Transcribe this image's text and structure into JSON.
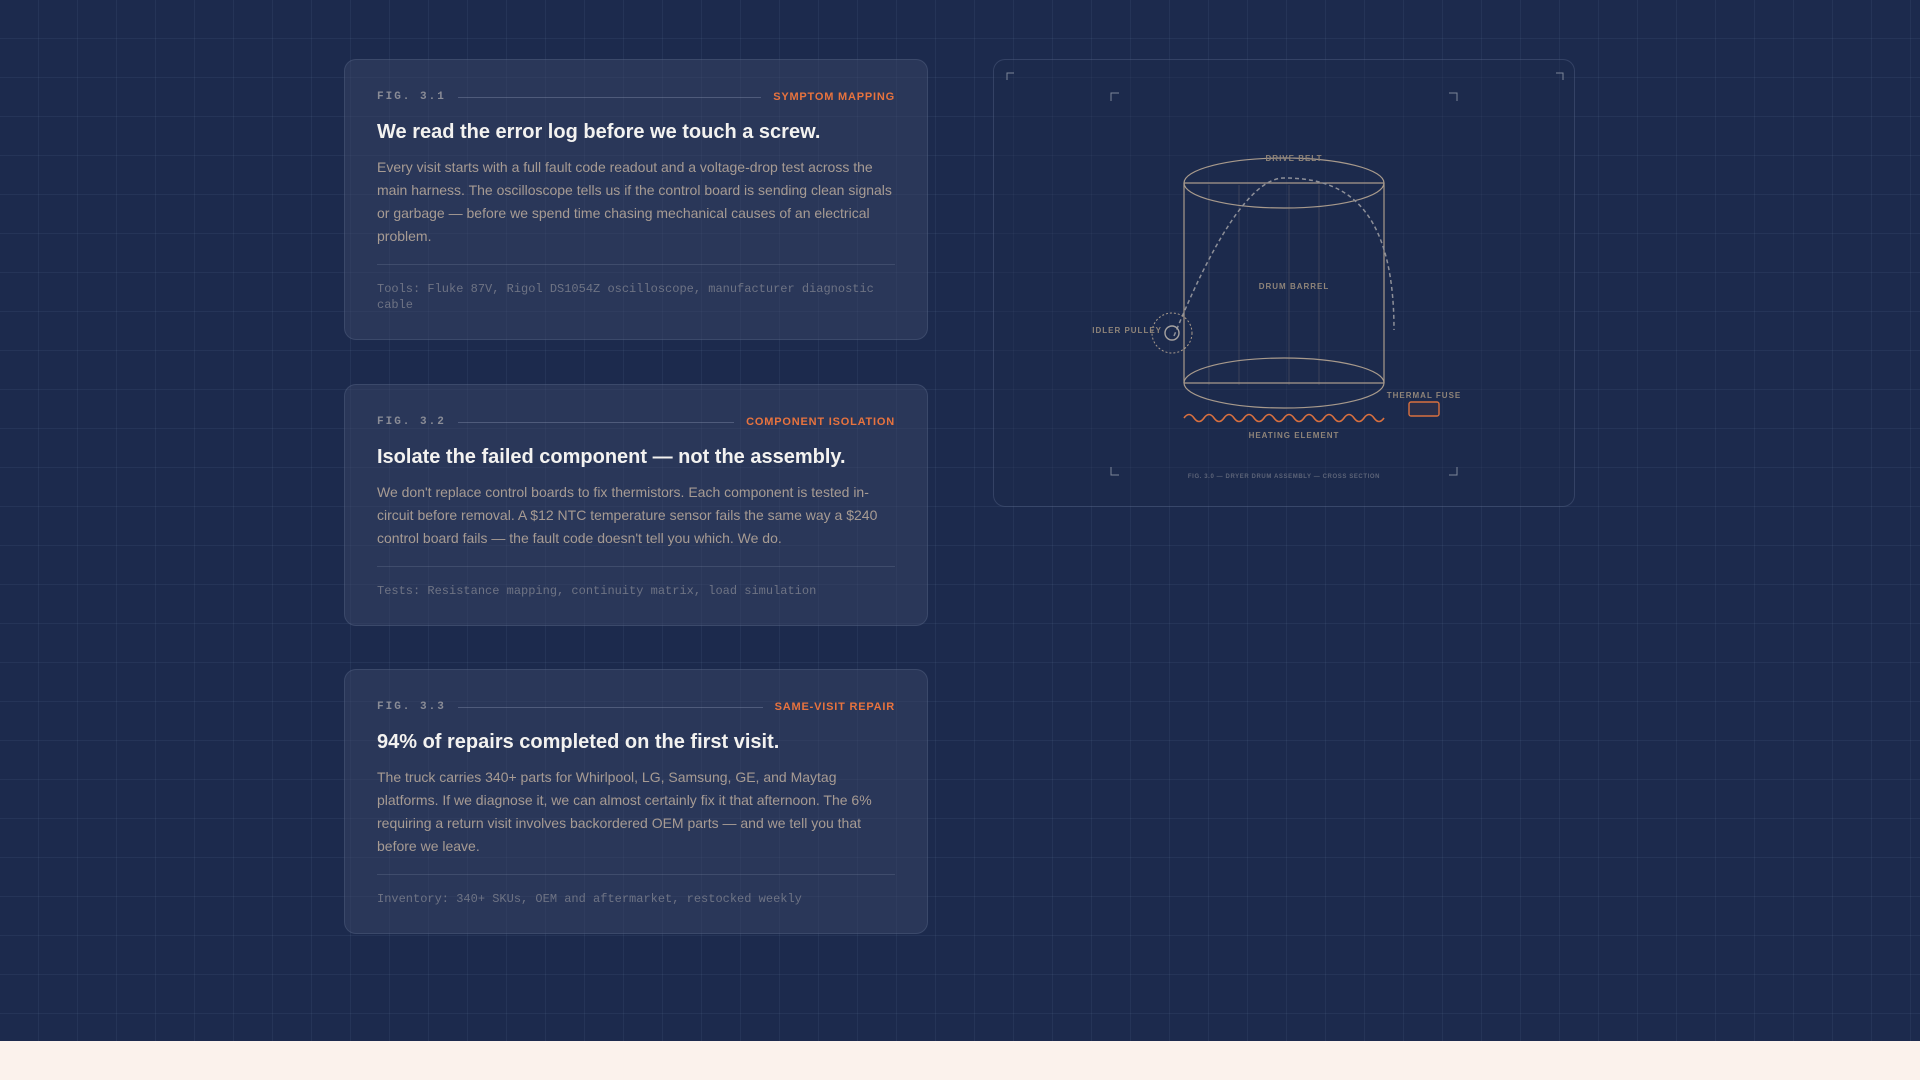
{
  "cards": [
    {
      "fig": "FIG. 3.1",
      "tag": "SYMPTOM MAPPING",
      "title": "We read the error log before we touch a screw.",
      "body": "Every visit starts with a full fault code readout and a voltage-drop test across the main harness. The oscilloscope tells us if the control board is sending clean signals or garbage — before we spend time chasing mechanical causes of an electrical problem.",
      "footer": "Tools: Fluke 87V, Rigol DS1054Z oscilloscope, manufacturer diagnostic cable"
    },
    {
      "fig": "FIG. 3.2",
      "tag": "COMPONENT ISOLATION",
      "title": "Isolate the failed component — not the assembly.",
      "body": "We don't replace control boards to fix thermistors. Each component is tested in-circuit before removal. A $12 NTC temperature sensor fails the same way a $240 control board fails — the fault code doesn't tell you which. We do.",
      "footer": "Tests: Resistance mapping, continuity matrix, load simulation"
    },
    {
      "fig": "FIG. 3.3",
      "tag": "SAME-VISIT REPAIR",
      "title": "94% of repairs completed on the first visit.",
      "body": "The truck carries 340+ parts for Whirlpool, LG, Samsung, GE, and Maytag platforms. If we diagnose it, we can almost certainly fix it that afternoon. The 6% requiring a return visit involves backordered OEM parts — and we tell you that before we leave.",
      "footer": "Inventory: 340+ SKUs, OEM and aftermarket, restocked weekly"
    }
  ],
  "diagram": {
    "labels": {
      "drive_belt": "DRIVE BELT",
      "drum_barrel": "DRUM BARREL",
      "idler_pulley": "IDLER PULLEY",
      "thermal_fuse": "THERMAL FUSE",
      "heating_element": "HEATING ELEMENT"
    },
    "caption": "FIG. 3.0 — DRYER DRUM ASSEMBLY — CROSS SECTION"
  },
  "colors": {
    "background": "#1c2a4d",
    "accent": "#e8733e",
    "footer_strip": "#fbf2ec"
  }
}
